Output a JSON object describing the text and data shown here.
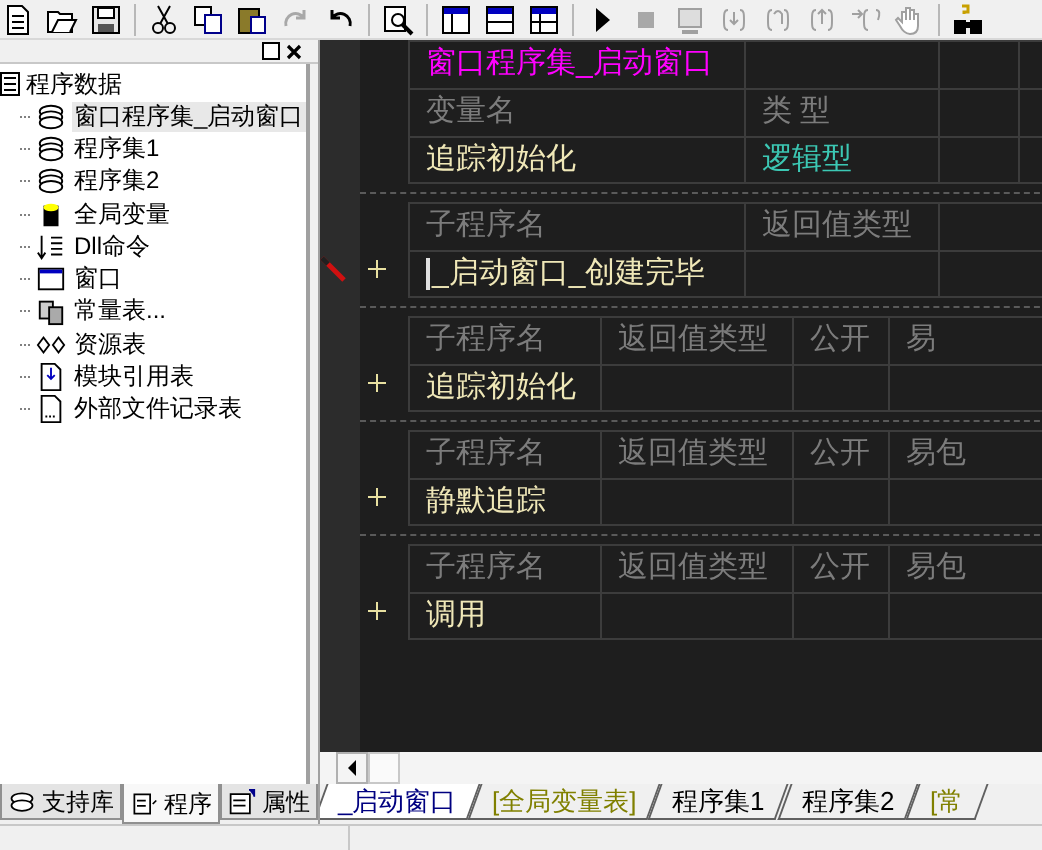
{
  "tree": {
    "label": "程序数据",
    "children": [
      {
        "label": "窗口程序集_启动窗口",
        "kind": "assembly",
        "selected": true
      },
      {
        "label": "程序集1",
        "kind": "assembly",
        "selected": false
      },
      {
        "label": "程序集2",
        "kind": "assembly",
        "selected": false
      },
      {
        "label": "全局变量",
        "kind": "variable",
        "selected": false
      },
      {
        "label": "Dll命令",
        "kind": "dll",
        "selected": false
      },
      {
        "label": "窗口",
        "kind": "window",
        "selected": false
      },
      {
        "label": "常量表...",
        "kind": "constant",
        "selected": false
      },
      {
        "label": "资源表",
        "kind": "resource",
        "selected": false
      },
      {
        "label": "模块引用表",
        "kind": "module",
        "selected": false
      },
      {
        "label": "外部文件记录表",
        "kind": "file",
        "selected": false
      }
    ]
  },
  "panel_tabs": [
    {
      "label": "支持库",
      "kind": "library",
      "selected": false
    },
    {
      "label": "程序",
      "kind": "program",
      "selected": true
    },
    {
      "label": "属性",
      "kind": "property",
      "selected": false
    }
  ],
  "editor": {
    "blocks": [
      {
        "kind": "assembly",
        "title": "窗口程序集_启动窗口",
        "columns": [
          "变量名",
          "类 型"
        ],
        "rows": [
          [
            "追踪初始化",
            "逻辑型"
          ]
        ]
      },
      {
        "kind": "sub",
        "columns": [
          "子程序名",
          "返回值类型"
        ],
        "name": "_启动窗口_创建完毕",
        "current": true
      },
      {
        "kind": "sub",
        "columns": [
          "子程序名",
          "返回值类型",
          "公开",
          "易"
        ],
        "name": "追踪初始化",
        "current": false
      },
      {
        "kind": "sub",
        "columns": [
          "子程序名",
          "返回值类型",
          "公开",
          "易包"
        ],
        "name": "静默追踪",
        "current": false
      },
      {
        "kind": "sub",
        "columns": [
          "子程序名",
          "返回值类型",
          "公开",
          "易包"
        ],
        "name": "调用",
        "current": false
      }
    ]
  },
  "editor_tabs": [
    {
      "label": "_启动窗口",
      "kind": "window",
      "selected": true
    },
    {
      "label": "[全局变量表]",
      "kind": "table",
      "selected": false
    },
    {
      "label": "程序集1",
      "kind": "assembly",
      "selected": false
    },
    {
      "label": "程序集2",
      "kind": "assembly",
      "selected": false
    },
    {
      "label": "[常",
      "kind": "table",
      "selected": false
    }
  ]
}
